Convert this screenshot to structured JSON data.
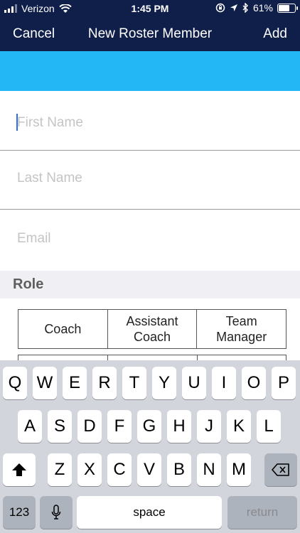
{
  "status_bar": {
    "carrier": "Verizon",
    "time": "1:45 PM",
    "battery_percent": "61%",
    "battery_level": 0.61,
    "icons": [
      "signal-icon",
      "wifi-icon",
      "orientation-lock-icon",
      "location-icon",
      "bluetooth-icon",
      "battery-icon"
    ]
  },
  "nav": {
    "cancel_label": "Cancel",
    "title": "New Roster Member",
    "add_label": "Add"
  },
  "form": {
    "first_name": {
      "placeholder": "First Name",
      "value": ""
    },
    "last_name": {
      "placeholder": "Last Name",
      "value": ""
    },
    "email": {
      "placeholder": "Email",
      "value": ""
    }
  },
  "role": {
    "section_title": "Role",
    "options": [
      {
        "label": "Coach"
      },
      {
        "label": "Assistant\nCoach"
      },
      {
        "label": "Team\nManager"
      }
    ]
  },
  "keyboard": {
    "row1": [
      "Q",
      "W",
      "E",
      "R",
      "T",
      "Y",
      "U",
      "I",
      "O",
      "P"
    ],
    "row2": [
      "A",
      "S",
      "D",
      "F",
      "G",
      "H",
      "J",
      "K",
      "L"
    ],
    "row3": [
      "Z",
      "X",
      "C",
      "V",
      "B",
      "N",
      "M"
    ],
    "numbers_label": "123",
    "space_label": "space",
    "return_label": "return"
  },
  "colors": {
    "nav_background": "#0f1f4a",
    "banner": "#23b7f5",
    "section_background": "#efeff4",
    "keyboard_background": "#d2d5db"
  }
}
